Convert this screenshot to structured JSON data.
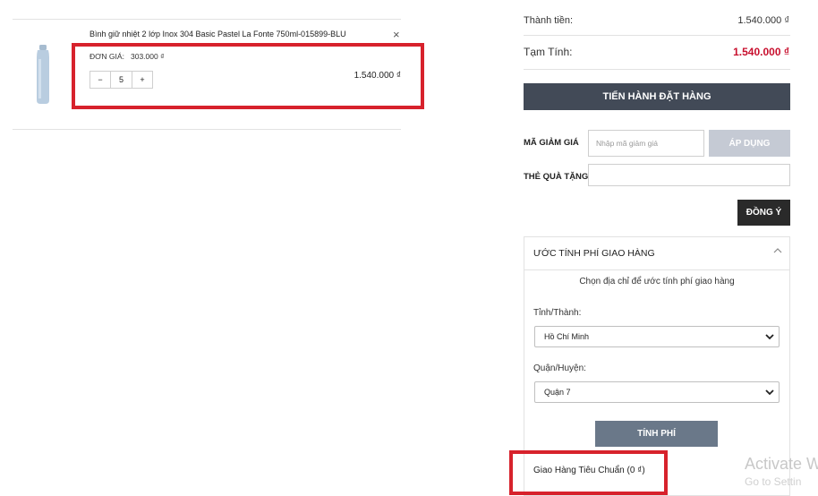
{
  "cart": {
    "product_name": "Bình giữ nhiệt 2 lớp Inox 304 Basic Pastel La Fonte 750ml-015899-BLU",
    "remove_icon": "×",
    "unit_price_label": "ĐƠN GIÁ:",
    "unit_price": "303.000 ₫",
    "quantity": "5",
    "minus_label": "−",
    "plus_label": "+",
    "line_total": "1.540.000 ₫",
    "product_color": "#b9cde0"
  },
  "summary": {
    "total_label": "Thành tiền:",
    "total_value": "1.540.000 ₫",
    "subtotal_label": "Tạm Tính:",
    "subtotal_value": "1.540.000 ₫",
    "checkout_label": "TIẾN HÀNH ĐẶT HÀNG"
  },
  "coupon": {
    "label": "MÃ GIẢM GIÁ",
    "placeholder": "Nhập mã giảm giá",
    "apply_label": "ÁP DỤNG"
  },
  "gift": {
    "label": "THẺ QUÀ TẶNG",
    "agree_label": "ĐỒNG Ý"
  },
  "shipping": {
    "title": "ƯỚC TÍNH PHÍ GIAO HÀNG",
    "chevron_icon": "chevron-up-icon",
    "hint": "Chọn địa chỉ để ước tính phí giao hàng",
    "province_label": "Tỉnh/Thành:",
    "province_value": "Hồ Chí Minh",
    "district_label": "Quận/Huyện:",
    "district_value": "Quận 7",
    "calc_label": "TÍNH PHÍ",
    "option_label": "Giao Hàng Tiêu Chuẩn (0 ₫)"
  },
  "watermark": {
    "line1": "Activate W",
    "line2": "Go to Settin"
  },
  "colors": {
    "highlight": "#d7222c",
    "price_red": "#c8102e",
    "checkout_bg": "#424a57"
  }
}
